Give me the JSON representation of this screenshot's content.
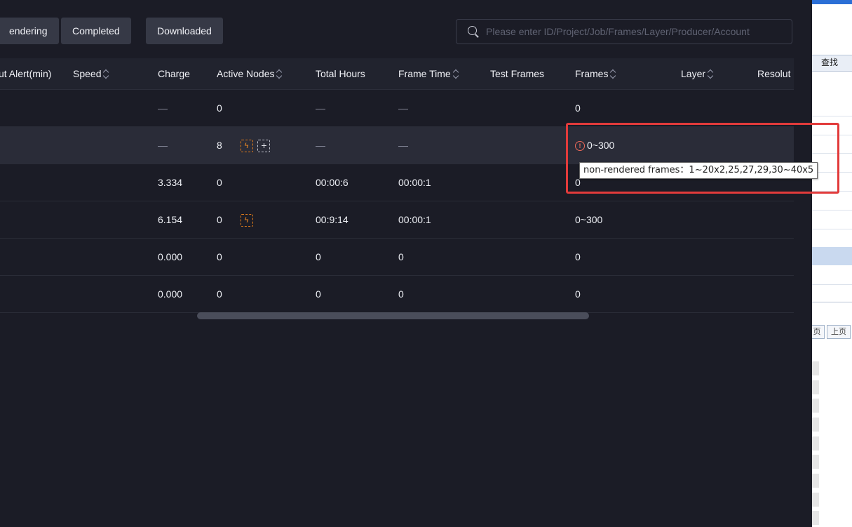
{
  "filters": {
    "rendering": "endering",
    "completed": "Completed",
    "downloaded": "Downloaded"
  },
  "search": {
    "placeholder": "Please enter ID/Project/Job/Frames/Layer/Producer/Account",
    "icon": "search-icon"
  },
  "columns": {
    "timeout_alert": "ut Alert(min)",
    "speed": "Speed",
    "charge": "Charge",
    "active_nodes": "Active Nodes",
    "total_hours": "Total Hours",
    "frame_time": "Frame Time",
    "test_frames": "Test Frames",
    "frames": "Frames",
    "layer": "Layer",
    "resolution": "Resolut"
  },
  "rows": [
    {
      "charge": "—",
      "active_nodes": "0",
      "total_hours": "—",
      "frame_time": "—",
      "frames": "0"
    },
    {
      "charge": "—",
      "active_nodes": "8",
      "total_hours": "—",
      "frame_time": "—",
      "frames": "0~300"
    },
    {
      "charge": "3.334",
      "active_nodes": "0",
      "total_hours": "00:00:6",
      "frame_time": "00:00:1",
      "frames": "0"
    },
    {
      "charge": "6.154",
      "active_nodes": "0",
      "total_hours": "00:9:14",
      "frame_time": "00:00:1",
      "frames": "0~300"
    },
    {
      "charge": "0.000",
      "active_nodes": "0",
      "total_hours": "0",
      "frame_time": "0",
      "frames": "0"
    },
    {
      "charge": "0.000",
      "active_nodes": "0",
      "total_hours": "0",
      "frame_time": "0",
      "frames": "0"
    }
  ],
  "tooltip": {
    "text": "non-rendered frames：1~20x2,25,27,29,30~40x5"
  },
  "side_window": {
    "find_label": "查找",
    "prev_page_partial": "页",
    "prev_page": "上页"
  },
  "colors": {
    "background": "#1b1c26",
    "header": "#21232e",
    "button": "#363946",
    "accent_orange": "#f08a22",
    "warning_red": "#f06a5a",
    "highlight_red": "#e23b3b"
  }
}
